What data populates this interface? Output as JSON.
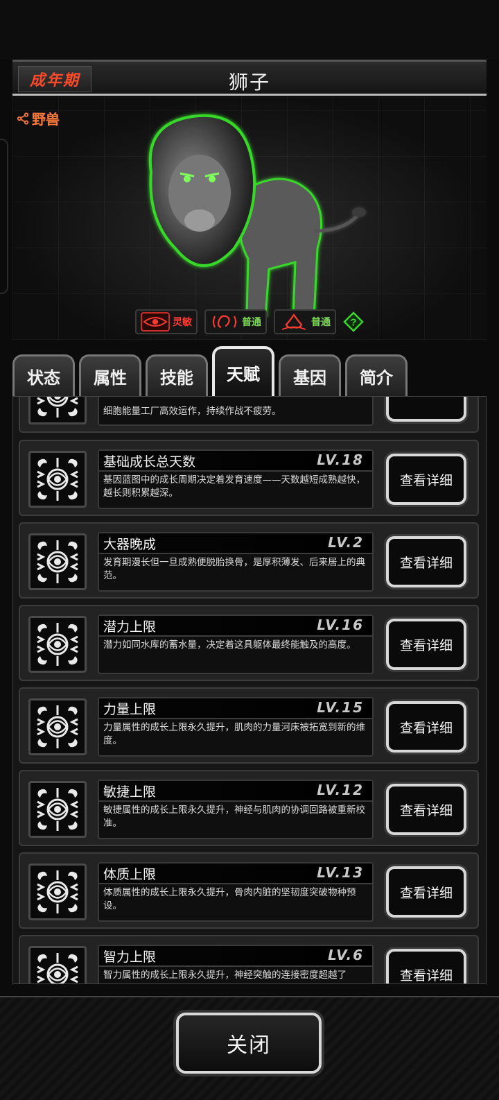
{
  "header": {
    "stage": "成年期",
    "title": "狮子"
  },
  "hero": {
    "share_label": "野兽"
  },
  "traits": [
    {
      "icon": "eye-icon",
      "label": "灵敏",
      "color": "#ff3b30"
    },
    {
      "icon": "ear-icon",
      "label": "普通",
      "color": "#7ed957"
    },
    {
      "icon": "nose-icon",
      "label": "普通",
      "color": "#7ed957"
    }
  ],
  "tabs": [
    "状态",
    "属性",
    "技能",
    "天赋",
    "基因",
    "简介"
  ],
  "active_tab": "天赋",
  "talents": {
    "partial_top": {
      "desc": "细胞能量工厂高效运作，持续作战不疲劳。"
    },
    "items": [
      {
        "name": "基础成长总天数",
        "level": "LV.18",
        "desc": "基因蓝图中的成长周期决定着发育速度——天数越短成熟越快，越长则积累越深。",
        "button": "查看详细"
      },
      {
        "name": "大器晚成",
        "level": "LV.2",
        "desc": "发育期漫长但一旦成熟便脱胎换骨，是厚积薄发、后来居上的典范。",
        "button": "查看详细"
      },
      {
        "name": "潜力上限",
        "level": "LV.16",
        "desc": "潜力如同水库的蓄水量，决定着这具躯体最终能触及的高度。",
        "button": "查看详细"
      },
      {
        "name": "力量上限",
        "level": "LV.15",
        "desc": "力量属性的成长上限永久提升，肌肉的力量河床被拓宽到新的维度。",
        "button": "查看详细"
      },
      {
        "name": "敏捷上限",
        "level": "LV.12",
        "desc": "敏捷属性的成长上限永久提升，神经与肌肉的协调回路被重新校准。",
        "button": "查看详细"
      },
      {
        "name": "体质上限",
        "level": "LV.13",
        "desc": "体质属性的成长上限永久提升，骨肉内脏的坚韧度突破物种预设。",
        "button": "查看详细"
      },
      {
        "name": "智力上限",
        "level": "LV.6",
        "desc": "智力属性的成长上限永久提升，神经突触的连接密度超越了",
        "button": "查看详细"
      }
    ]
  },
  "footer": {
    "close_label": "关闭"
  }
}
